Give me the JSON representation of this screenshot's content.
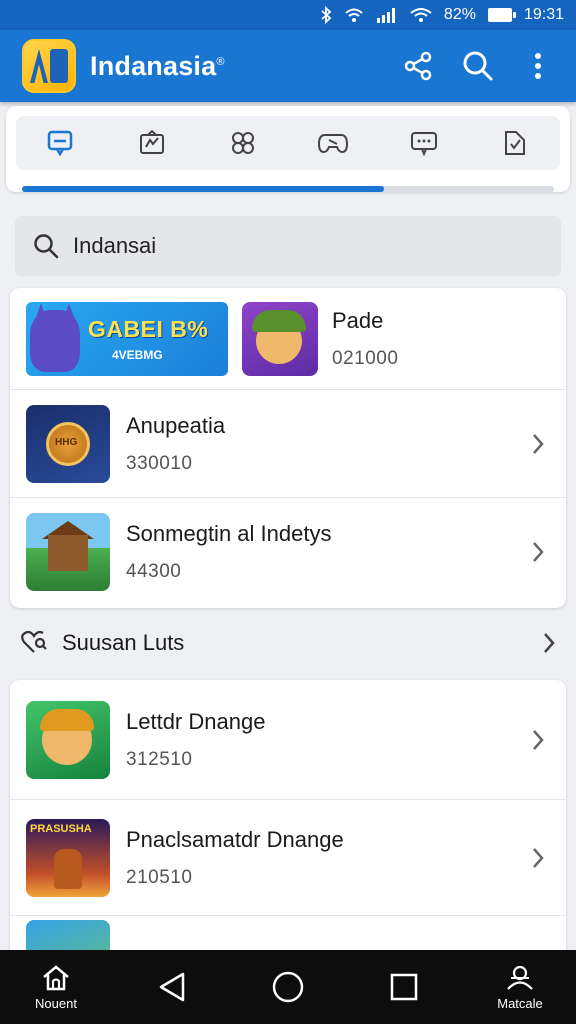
{
  "status_bar": {
    "battery_text": "82%",
    "time": "19:31"
  },
  "app_bar": {
    "title": "Indanasia",
    "title_mark": "®"
  },
  "tabs": {
    "progress": 0.68
  },
  "search": {
    "value": "Indansai"
  },
  "featured": {
    "banner_title": "GABEI B%",
    "banner_subtitle": "4VEBMG",
    "item_title": "Pade",
    "item_subtitle": "021000"
  },
  "list_1": [
    {
      "title": "Anupeatia",
      "subtitle": "330010"
    },
    {
      "title": "Sonmegtin al Indetys",
      "subtitle": "44300"
    }
  ],
  "section": {
    "label": "Suusan Luts"
  },
  "list_2": [
    {
      "title": "Lettdr Dnange",
      "subtitle": "312510"
    },
    {
      "title": "Pnaclsamatdr Dnange",
      "subtitle": "210510",
      "thumb_text": "PRASUSHA"
    }
  ],
  "thumb_labels": {
    "shield": "HHG"
  },
  "nav": {
    "home_label": "Nouent",
    "profile_label": "Matcale"
  },
  "colors": {
    "primary": "#1976d2",
    "status_bar": "#1565c0",
    "nav_bar": "#0d0d0d"
  }
}
